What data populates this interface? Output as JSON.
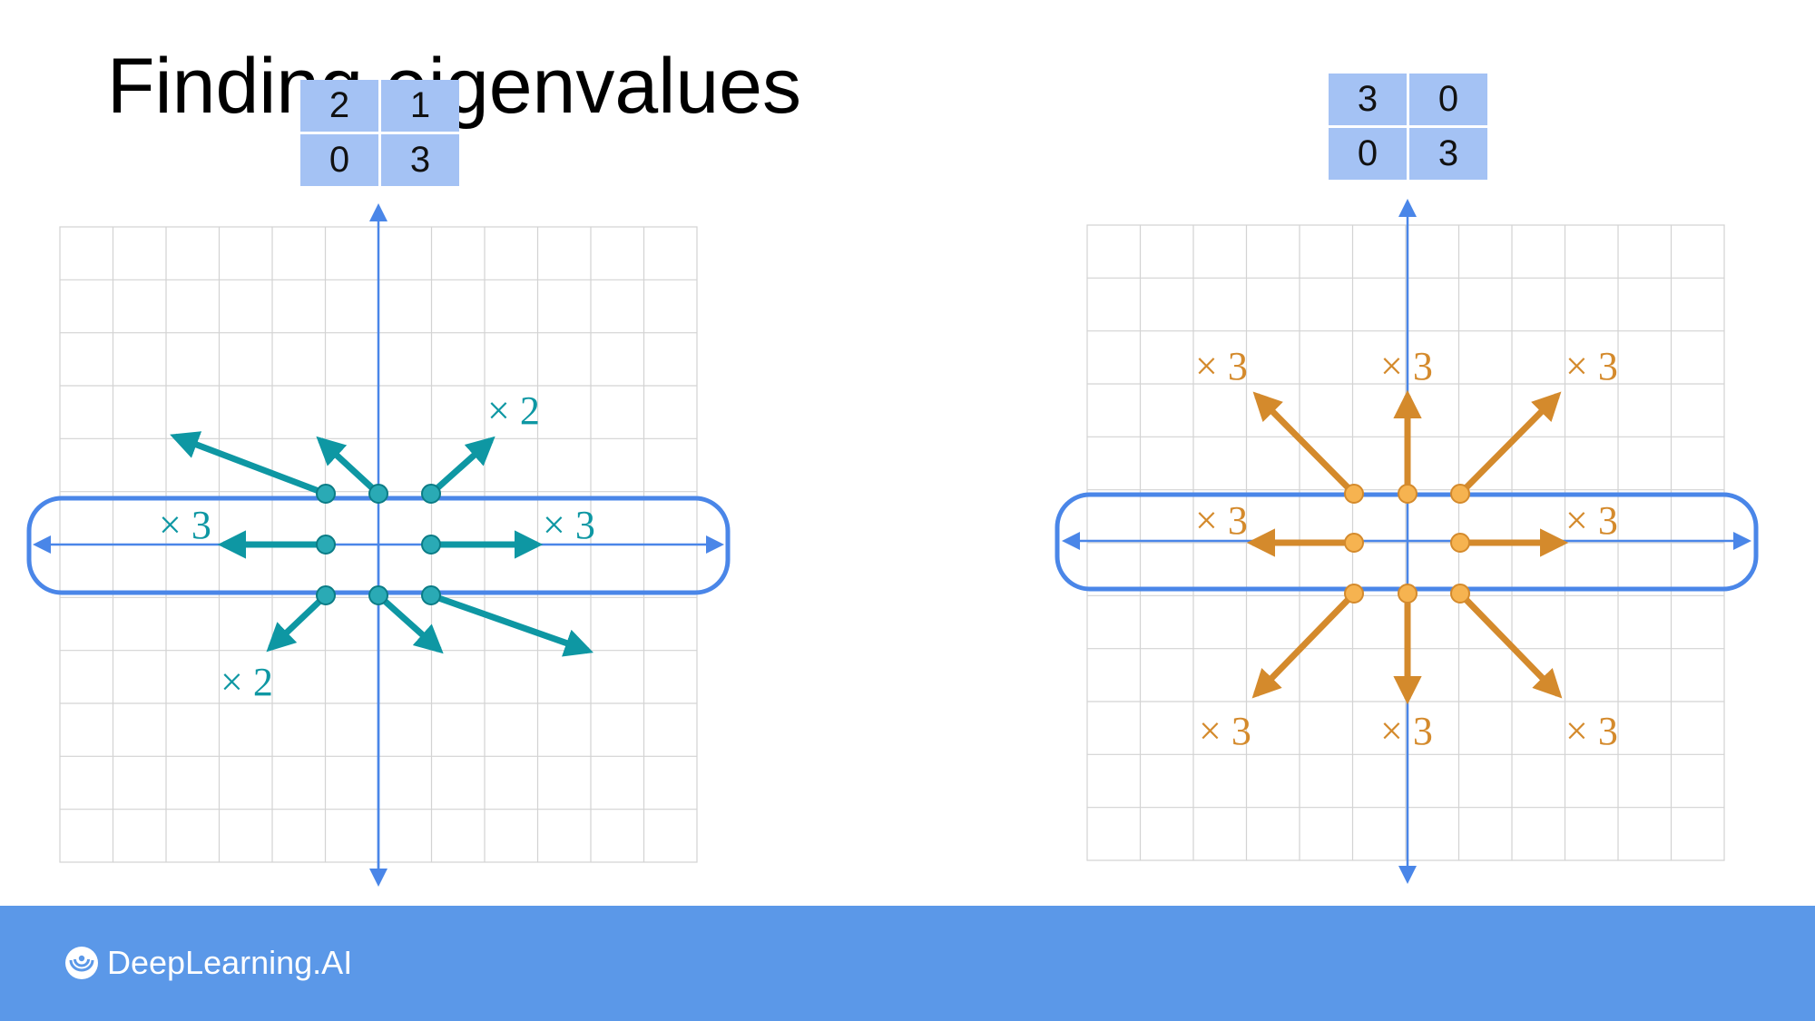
{
  "title": "Finding eigenvalues",
  "left_panel": {
    "matrix": [
      [
        "2",
        "1"
      ],
      [
        "0",
        "3"
      ]
    ],
    "labels": [
      "× 2",
      "× 3",
      "× 3",
      "× 2"
    ],
    "colors": {
      "arrow": "#0e97a3",
      "point": "#2aaab5",
      "axis": "#4a86e8"
    }
  },
  "right_panel": {
    "matrix": [
      [
        "3",
        "0"
      ],
      [
        "0",
        "3"
      ]
    ],
    "labels": [
      "× 3",
      "× 3",
      "× 3",
      "× 3",
      "× 3",
      "× 3",
      "× 3",
      "× 3"
    ],
    "colors": {
      "arrow": "#d48a2c",
      "point": "#f6b350",
      "axis": "#4a86e8"
    }
  },
  "footer": {
    "brand": "DeepLearning.AI",
    "color": "#5b98e8"
  }
}
